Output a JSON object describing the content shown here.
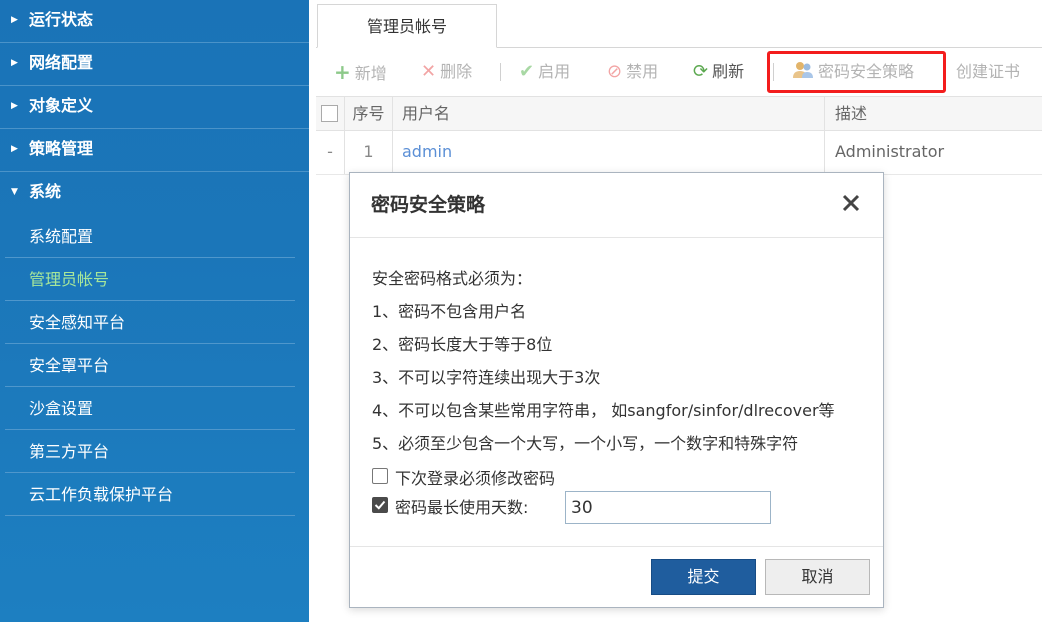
{
  "sidebar": {
    "sections": [
      {
        "label": "运行状态",
        "expanded": false
      },
      {
        "label": "网络配置",
        "expanded": false
      },
      {
        "label": "对象定义",
        "expanded": false
      },
      {
        "label": "策略管理",
        "expanded": false
      },
      {
        "label": "系统",
        "expanded": true
      }
    ],
    "items": [
      {
        "label": "系统配置"
      },
      {
        "label": "管理员帐号",
        "active": true
      },
      {
        "label": "安全感知平台"
      },
      {
        "label": "安全罩平台"
      },
      {
        "label": "沙盒设置"
      },
      {
        "label": "第三方平台"
      },
      {
        "label": "云工作负载保护平台"
      }
    ]
  },
  "tabs": [
    {
      "label": "管理员帐号"
    }
  ],
  "toolbar": {
    "add": "新增",
    "delete": "删除",
    "enable": "启用",
    "disable": "禁用",
    "refresh": "刷新",
    "password_policy": "密码安全策略",
    "create_cert": "创建证书"
  },
  "table": {
    "headers": {
      "index": "序号",
      "username": "用户名",
      "description": "描述"
    },
    "rows": [
      {
        "marker": "-",
        "index": "1",
        "username": "admin",
        "description": "Administrator"
      }
    ]
  },
  "dialog": {
    "title": "密码安全策略",
    "intro": "安全密码格式必须为：",
    "rules": [
      "1、密码不包含用户名",
      "2、密码长度大于等于8位",
      "3、不可以字符连续出现大于3次",
      "4、不可以包含某些常用字符串， 如sangfor/sinfor/dlrecover等",
      "5、必须至少包含一个大写，一个小写，一个数字和特殊字符"
    ],
    "force_change_label": "下次登录必须修改密码",
    "force_change_checked": false,
    "max_days_label": "密码最长使用天数:",
    "max_days_checked": true,
    "max_days_value": "30",
    "submit": "提交",
    "cancel": "取消"
  },
  "colors": {
    "sidebar_bg": "#1b76b9",
    "active_item": "#a7e79a",
    "link": "#5b8fd6",
    "highlight": "#f31d1d",
    "primary_button": "#1f5d9e"
  }
}
